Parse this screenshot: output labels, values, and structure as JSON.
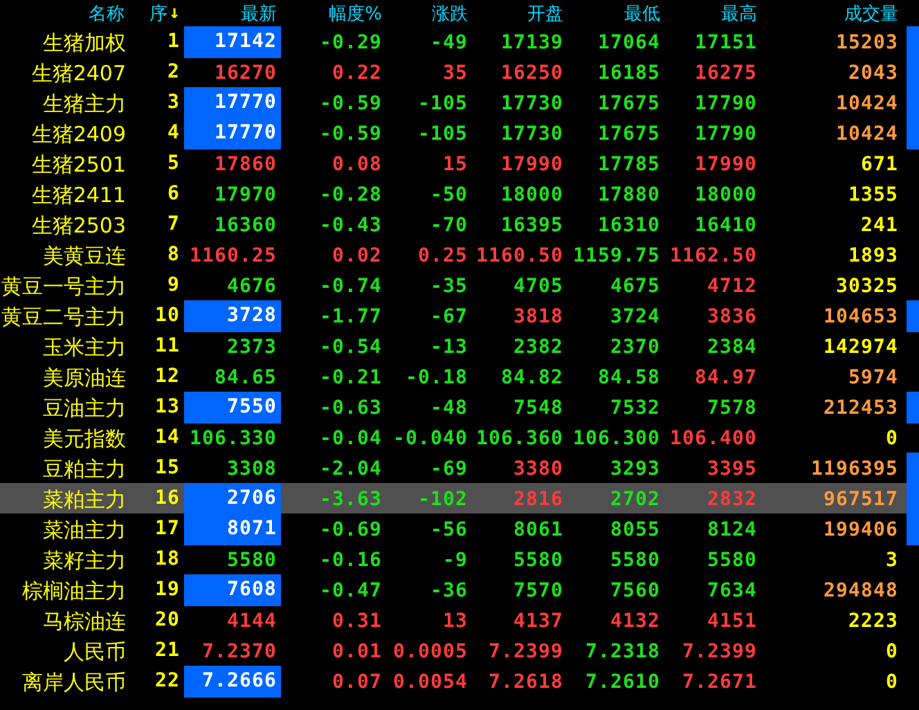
{
  "columns": [
    {
      "label": "名称"
    },
    {
      "label": "序",
      "sort_arrow": "↓"
    },
    {
      "label": "最新"
    },
    {
      "label": "幅度%"
    },
    {
      "label": "涨跌"
    },
    {
      "label": "开盘"
    },
    {
      "label": "最低"
    },
    {
      "label": "最高"
    },
    {
      "label": "成交量"
    }
  ],
  "rows": [
    {
      "name": "生猪加权",
      "seq": "1",
      "selected": false,
      "flash": true,
      "marker": true,
      "latest": {
        "text": "17142"
      },
      "pct": {
        "text": "-0.29",
        "color": "#1ee01e"
      },
      "change": {
        "text": "-49",
        "color": "#1ee01e"
      },
      "open": {
        "text": "17139",
        "color": "#1ee01e"
      },
      "low": {
        "text": "17064",
        "color": "#1ee01e"
      },
      "high": {
        "text": "17151",
        "color": "#1ee01e"
      },
      "volume": {
        "text": "15203",
        "color": "#ff9a40"
      }
    },
    {
      "name": "生猪2407",
      "seq": "2",
      "selected": false,
      "flash": false,
      "marker": true,
      "latest": {
        "text": "16270",
        "color": "#ff3c3c"
      },
      "pct": {
        "text": "0.22",
        "color": "#ff3c3c"
      },
      "change": {
        "text": "35",
        "color": "#ff3c3c"
      },
      "open": {
        "text": "16250",
        "color": "#ff3c3c"
      },
      "low": {
        "text": "16185",
        "color": "#1ee01e"
      },
      "high": {
        "text": "16275",
        "color": "#ff3c3c"
      },
      "volume": {
        "text": "2043",
        "color": "#ff9a40"
      }
    },
    {
      "name": "生猪主力",
      "seq": "3",
      "selected": false,
      "flash": true,
      "marker": true,
      "latest": {
        "text": "17770"
      },
      "pct": {
        "text": "-0.59",
        "color": "#1ee01e"
      },
      "change": {
        "text": "-105",
        "color": "#1ee01e"
      },
      "open": {
        "text": "17730",
        "color": "#1ee01e"
      },
      "low": {
        "text": "17675",
        "color": "#1ee01e"
      },
      "high": {
        "text": "17790",
        "color": "#1ee01e"
      },
      "volume": {
        "text": "10424",
        "color": "#ff9a40"
      }
    },
    {
      "name": "生猪2409",
      "seq": "4",
      "selected": false,
      "flash": true,
      "marker": true,
      "latest": {
        "text": "17770"
      },
      "pct": {
        "text": "-0.59",
        "color": "#1ee01e"
      },
      "change": {
        "text": "-105",
        "color": "#1ee01e"
      },
      "open": {
        "text": "17730",
        "color": "#1ee01e"
      },
      "low": {
        "text": "17675",
        "color": "#1ee01e"
      },
      "high": {
        "text": "17790",
        "color": "#1ee01e"
      },
      "volume": {
        "text": "10424",
        "color": "#ff9a40"
      }
    },
    {
      "name": "生猪2501",
      "seq": "5",
      "selected": false,
      "flash": false,
      "marker": false,
      "latest": {
        "text": "17860",
        "color": "#ff3c3c"
      },
      "pct": {
        "text": "0.08",
        "color": "#ff3c3c"
      },
      "change": {
        "text": "15",
        "color": "#ff3c3c"
      },
      "open": {
        "text": "17990",
        "color": "#ff3c3c"
      },
      "low": {
        "text": "17785",
        "color": "#1ee01e"
      },
      "high": {
        "text": "17990",
        "color": "#ff3c3c"
      },
      "volume": {
        "text": "671",
        "color": "#ffff00"
      }
    },
    {
      "name": "生猪2411",
      "seq": "6",
      "selected": false,
      "flash": false,
      "marker": false,
      "latest": {
        "text": "17970",
        "color": "#1ee01e"
      },
      "pct": {
        "text": "-0.28",
        "color": "#1ee01e"
      },
      "change": {
        "text": "-50",
        "color": "#1ee01e"
      },
      "open": {
        "text": "18000",
        "color": "#1ee01e"
      },
      "low": {
        "text": "17880",
        "color": "#1ee01e"
      },
      "high": {
        "text": "18000",
        "color": "#1ee01e"
      },
      "volume": {
        "text": "1355",
        "color": "#ffff00"
      }
    },
    {
      "name": "生猪2503",
      "seq": "7",
      "selected": false,
      "flash": false,
      "marker": false,
      "latest": {
        "text": "16360",
        "color": "#1ee01e"
      },
      "pct": {
        "text": "-0.43",
        "color": "#1ee01e"
      },
      "change": {
        "text": "-70",
        "color": "#1ee01e"
      },
      "open": {
        "text": "16395",
        "color": "#1ee01e"
      },
      "low": {
        "text": "16310",
        "color": "#1ee01e"
      },
      "high": {
        "text": "16410",
        "color": "#1ee01e"
      },
      "volume": {
        "text": "241",
        "color": "#ffff00"
      }
    },
    {
      "name": "美黄豆连",
      "seq": "8",
      "selected": false,
      "flash": false,
      "marker": false,
      "latest": {
        "text": "1160.25",
        "color": "#ff3c3c"
      },
      "pct": {
        "text": "0.02",
        "color": "#ff3c3c"
      },
      "change": {
        "text": "0.25",
        "color": "#ff3c3c"
      },
      "open": {
        "text": "1160.50",
        "color": "#ff3c3c"
      },
      "low": {
        "text": "1159.75",
        "color": "#1ee01e"
      },
      "high": {
        "text": "1162.50",
        "color": "#ff3c3c"
      },
      "volume": {
        "text": "1893",
        "color": "#ffff00"
      }
    },
    {
      "name": "黄豆一号主力",
      "seq": "9",
      "selected": false,
      "flash": false,
      "marker": false,
      "latest": {
        "text": "4676",
        "color": "#1ee01e"
      },
      "pct": {
        "text": "-0.74",
        "color": "#1ee01e"
      },
      "change": {
        "text": "-35",
        "color": "#1ee01e"
      },
      "open": {
        "text": "4705",
        "color": "#1ee01e"
      },
      "low": {
        "text": "4675",
        "color": "#1ee01e"
      },
      "high": {
        "text": "4712",
        "color": "#ff3c3c"
      },
      "volume": {
        "text": "30325",
        "color": "#ffff00"
      }
    },
    {
      "name": "黄豆二号主力",
      "seq": "10",
      "selected": false,
      "flash": true,
      "marker": true,
      "latest": {
        "text": "3728"
      },
      "pct": {
        "text": "-1.77",
        "color": "#1ee01e"
      },
      "change": {
        "text": "-67",
        "color": "#1ee01e"
      },
      "open": {
        "text": "3818",
        "color": "#ff3c3c"
      },
      "low": {
        "text": "3724",
        "color": "#1ee01e"
      },
      "high": {
        "text": "3836",
        "color": "#ff3c3c"
      },
      "volume": {
        "text": "104653",
        "color": "#ff9a40"
      }
    },
    {
      "name": "玉米主力",
      "seq": "11",
      "selected": false,
      "flash": false,
      "marker": false,
      "latest": {
        "text": "2373",
        "color": "#1ee01e"
      },
      "pct": {
        "text": "-0.54",
        "color": "#1ee01e"
      },
      "change": {
        "text": "-13",
        "color": "#1ee01e"
      },
      "open": {
        "text": "2382",
        "color": "#1ee01e"
      },
      "low": {
        "text": "2370",
        "color": "#1ee01e"
      },
      "high": {
        "text": "2384",
        "color": "#1ee01e"
      },
      "volume": {
        "text": "142974",
        "color": "#ffff00"
      }
    },
    {
      "name": "美原油连",
      "seq": "12",
      "selected": false,
      "flash": false,
      "marker": false,
      "latest": {
        "text": "84.65",
        "color": "#1ee01e"
      },
      "pct": {
        "text": "-0.21",
        "color": "#1ee01e"
      },
      "change": {
        "text": "-0.18",
        "color": "#1ee01e"
      },
      "open": {
        "text": "84.82",
        "color": "#1ee01e"
      },
      "low": {
        "text": "84.58",
        "color": "#1ee01e"
      },
      "high": {
        "text": "84.97",
        "color": "#ff3c3c"
      },
      "volume": {
        "text": "5974",
        "color": "#ff9a40"
      }
    },
    {
      "name": "豆油主力",
      "seq": "13",
      "selected": false,
      "flash": true,
      "marker": true,
      "latest": {
        "text": "7550"
      },
      "pct": {
        "text": "-0.63",
        "color": "#1ee01e"
      },
      "change": {
        "text": "-48",
        "color": "#1ee01e"
      },
      "open": {
        "text": "7548",
        "color": "#1ee01e"
      },
      "low": {
        "text": "7532",
        "color": "#1ee01e"
      },
      "high": {
        "text": "7578",
        "color": "#1ee01e"
      },
      "volume": {
        "text": "212453",
        "color": "#ff9a40"
      }
    },
    {
      "name": "美元指数",
      "seq": "14",
      "selected": false,
      "flash": false,
      "marker": false,
      "latest": {
        "text": "106.330",
        "color": "#1ee01e"
      },
      "pct": {
        "text": "-0.04",
        "color": "#1ee01e"
      },
      "change": {
        "text": "-0.040",
        "color": "#1ee01e"
      },
      "open": {
        "text": "106.360",
        "color": "#1ee01e"
      },
      "low": {
        "text": "106.300",
        "color": "#1ee01e"
      },
      "high": {
        "text": "106.400",
        "color": "#ff3c3c"
      },
      "volume": {
        "text": "0",
        "color": "#ffff00"
      }
    },
    {
      "name": "豆粕主力",
      "seq": "15",
      "selected": false,
      "flash": false,
      "marker": true,
      "latest": {
        "text": "3308",
        "color": "#1ee01e"
      },
      "pct": {
        "text": "-2.04",
        "color": "#1ee01e"
      },
      "change": {
        "text": "-69",
        "color": "#1ee01e"
      },
      "open": {
        "text": "3380",
        "color": "#ff3c3c"
      },
      "low": {
        "text": "3293",
        "color": "#1ee01e"
      },
      "high": {
        "text": "3395",
        "color": "#ff3c3c"
      },
      "volume": {
        "text": "1196395",
        "color": "#ff9a40"
      }
    },
    {
      "name": "菜粕主力",
      "seq": "16",
      "selected": true,
      "flash": true,
      "marker": true,
      "latest": {
        "text": "2706"
      },
      "pct": {
        "text": "-3.63",
        "color": "#1ee01e"
      },
      "change": {
        "text": "-102",
        "color": "#1ee01e"
      },
      "open": {
        "text": "2816",
        "color": "#ff3c3c"
      },
      "low": {
        "text": "2702",
        "color": "#1ee01e"
      },
      "high": {
        "text": "2832",
        "color": "#ff3c3c"
      },
      "volume": {
        "text": "967517",
        "color": "#ff9a40"
      }
    },
    {
      "name": "菜油主力",
      "seq": "17",
      "selected": false,
      "flash": true,
      "marker": true,
      "latest": {
        "text": "8071"
      },
      "pct": {
        "text": "-0.69",
        "color": "#1ee01e"
      },
      "change": {
        "text": "-56",
        "color": "#1ee01e"
      },
      "open": {
        "text": "8061",
        "color": "#1ee01e"
      },
      "low": {
        "text": "8055",
        "color": "#1ee01e"
      },
      "high": {
        "text": "8124",
        "color": "#1ee01e"
      },
      "volume": {
        "text": "199406",
        "color": "#ff9a40"
      }
    },
    {
      "name": "菜籽主力",
      "seq": "18",
      "selected": false,
      "flash": false,
      "marker": false,
      "latest": {
        "text": "5580",
        "color": "#1ee01e"
      },
      "pct": {
        "text": "-0.16",
        "color": "#1ee01e"
      },
      "change": {
        "text": "-9",
        "color": "#1ee01e"
      },
      "open": {
        "text": "5580",
        "color": "#1ee01e"
      },
      "low": {
        "text": "5580",
        "color": "#1ee01e"
      },
      "high": {
        "text": "5580",
        "color": "#1ee01e"
      },
      "volume": {
        "text": "3",
        "color": "#ffff00"
      }
    },
    {
      "name": "棕榈油主力",
      "seq": "19",
      "selected": false,
      "flash": true,
      "marker": false,
      "latest": {
        "text": "7608"
      },
      "pct": {
        "text": "-0.47",
        "color": "#1ee01e"
      },
      "change": {
        "text": "-36",
        "color": "#1ee01e"
      },
      "open": {
        "text": "7570",
        "color": "#1ee01e"
      },
      "low": {
        "text": "7560",
        "color": "#1ee01e"
      },
      "high": {
        "text": "7634",
        "color": "#1ee01e"
      },
      "volume": {
        "text": "294848",
        "color": "#ff9a40"
      }
    },
    {
      "name": "马棕油连",
      "seq": "20",
      "selected": false,
      "flash": false,
      "marker": false,
      "latest": {
        "text": "4144",
        "color": "#ff3c3c"
      },
      "pct": {
        "text": "0.31",
        "color": "#ff3c3c"
      },
      "change": {
        "text": "13",
        "color": "#ff3c3c"
      },
      "open": {
        "text": "4137",
        "color": "#ff3c3c"
      },
      "low": {
        "text": "4132",
        "color": "#ff3c3c"
      },
      "high": {
        "text": "4151",
        "color": "#ff3c3c"
      },
      "volume": {
        "text": "2223",
        "color": "#ffff00"
      }
    },
    {
      "name": "人民币",
      "seq": "21",
      "selected": false,
      "flash": false,
      "marker": false,
      "latest": {
        "text": "7.2370",
        "color": "#ff3c3c"
      },
      "pct": {
        "text": "0.01",
        "color": "#ff3c3c"
      },
      "change": {
        "text": "0.0005",
        "color": "#ff3c3c"
      },
      "open": {
        "text": "7.2399",
        "color": "#ff3c3c"
      },
      "low": {
        "text": "7.2318",
        "color": "#1ee01e"
      },
      "high": {
        "text": "7.2399",
        "color": "#ff3c3c"
      },
      "volume": {
        "text": "0",
        "color": "#ffff00"
      }
    },
    {
      "name": "离岸人民币",
      "seq": "22",
      "selected": false,
      "flash": true,
      "marker": false,
      "latest": {
        "text": "7.2666"
      },
      "pct": {
        "text": "0.07",
        "color": "#ff3c3c"
      },
      "change": {
        "text": "0.0054",
        "color": "#ff3c3c"
      },
      "open": {
        "text": "7.2618",
        "color": "#ff3c3c"
      },
      "low": {
        "text": "7.2610",
        "color": "#1ee01e"
      },
      "high": {
        "text": "7.2671",
        "color": "#ff3c3c"
      },
      "volume": {
        "text": "0",
        "color": "#ffff00"
      }
    }
  ]
}
